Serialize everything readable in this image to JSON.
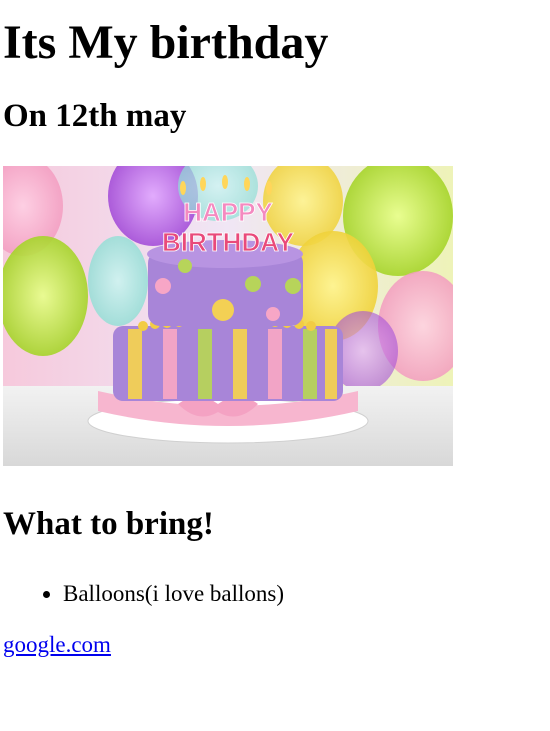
{
  "header": {
    "title": "Its My birthday",
    "date": "On 12th may"
  },
  "image": {
    "alt": "Happy Birthday cake",
    "candle_text_top": "HAPPY",
    "candle_text_bottom": "BIRTHDAY"
  },
  "bring": {
    "heading": "What to bring!",
    "items": [
      {
        "label": "Balloons(i love ballons)"
      }
    ]
  },
  "footer": {
    "link_text": "google.com"
  },
  "colors": {
    "link": "#0000ee",
    "text": "#000000",
    "background": "#ffffff"
  }
}
